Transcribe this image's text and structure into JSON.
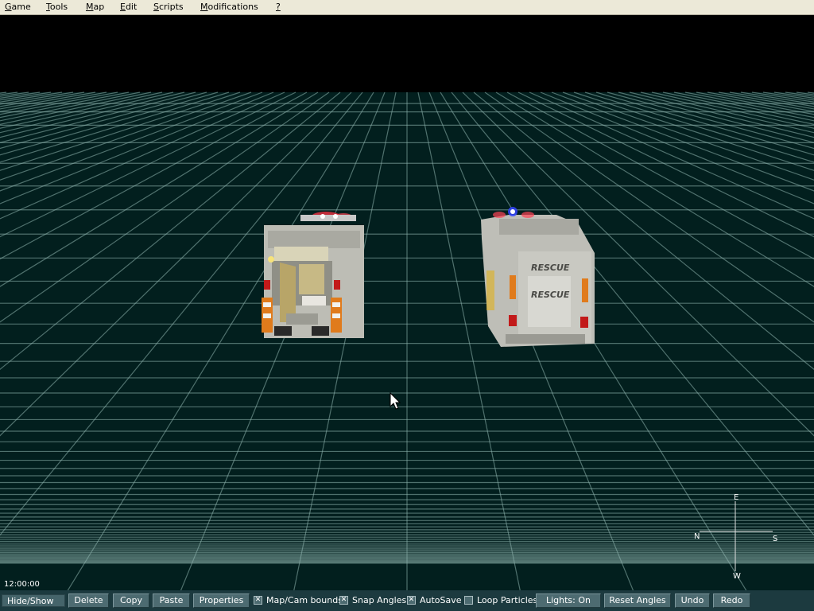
{
  "menu": {
    "items": [
      {
        "accel": "G",
        "rest": "ame"
      },
      {
        "accel": "T",
        "rest": "ools"
      },
      {
        "accel": "M",
        "rest": "ap"
      },
      {
        "accel": "E",
        "rest": "dit"
      },
      {
        "accel": "S",
        "rest": "cripts"
      },
      {
        "accel": "M",
        "rest": "odifications"
      },
      {
        "accel": "?",
        "rest": ""
      }
    ]
  },
  "viewport": {
    "sky_color": "#000000",
    "ground_color": "#021f1e",
    "grid_color": "#8fb5ae",
    "vehicles": [
      {
        "type": "fire-engine",
        "lights": "red"
      },
      {
        "type": "rescue-truck",
        "panel_text": "RESCUE",
        "lights": "blue-red"
      }
    ],
    "compass": {
      "north": "N",
      "east": "E",
      "south": "S",
      "west": "W"
    }
  },
  "clock": "12:00:00",
  "toolbar": {
    "hide_show": "Hide/Show",
    "delete": "Delete",
    "copy": "Copy",
    "paste": "Paste",
    "properties": "Properties",
    "map_cam_bounds": {
      "label": "Map/Cam bounds",
      "checked": true
    },
    "snap_angles": {
      "label": "Snap Angles",
      "checked": true
    },
    "autosave": {
      "label": "AutoSave",
      "checked": true
    },
    "loop_particles": {
      "label": "Loop Particles",
      "checked": false
    },
    "lights": "Lights: On",
    "reset_angles": "Reset Angles",
    "undo": "Undo",
    "redo": "Redo"
  }
}
